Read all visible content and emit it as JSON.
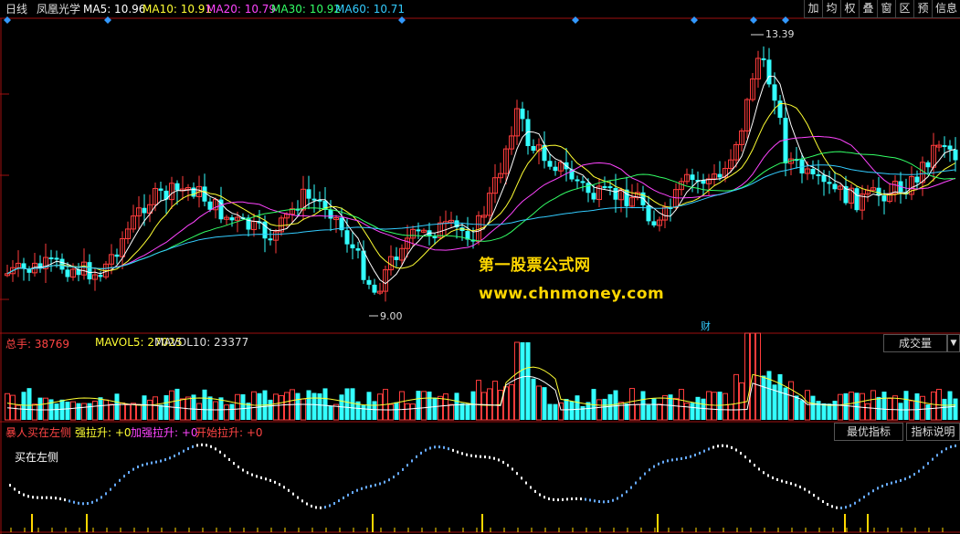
{
  "header": {
    "period": "日线",
    "stock_name": "凤凰光学",
    "ma": [
      {
        "label": "MA5: 10.96",
        "color": "#ffffff"
      },
      {
        "label": "MA10: 10.91",
        "color": "#ffff33"
      },
      {
        "label": "MA20: 10.79",
        "color": "#ff44ff"
      },
      {
        "label": "MA30: 10.92",
        "color": "#33ff66"
      },
      {
        "label": "MA60: 10.71",
        "color": "#33ccff"
      }
    ],
    "buttons": [
      "加",
      "均",
      "权",
      "叠",
      "窗",
      "区",
      "预",
      "信息"
    ]
  },
  "price_annotations": {
    "high": "13.39",
    "low": "9.00",
    "event_marker": "财"
  },
  "watermark": {
    "line1": "第一股票公式网",
    "line2": "www.chnmoney.com"
  },
  "volume_panel": {
    "name": "总手: 38769",
    "mavol5": "MAVOL5: 27025",
    "mavol10": "MAVOL10: 23377",
    "selector": "成交量"
  },
  "indicator_panel": {
    "items": [
      {
        "label": "暴人买在左侧",
        "color": "#ff4444"
      },
      {
        "label": "强拉升: +0",
        "color": "#ffff33"
      },
      {
        "label": "加强拉升: +0",
        "color": "#ff44ff"
      },
      {
        "label": "开始拉升: +0",
        "color": "#ff4444"
      }
    ],
    "inner_label": "买在左侧",
    "btn_best": "最优指标",
    "btn_explain": "指标说明"
  },
  "colors": {
    "up": "#ff3c3c",
    "down": "#33ffff",
    "ma5": "#ffffff",
    "ma10": "#ffff33",
    "ma20": "#ff44ff",
    "ma30": "#33ff66",
    "ma60": "#33ccff",
    "divider": "#a01010"
  }
}
